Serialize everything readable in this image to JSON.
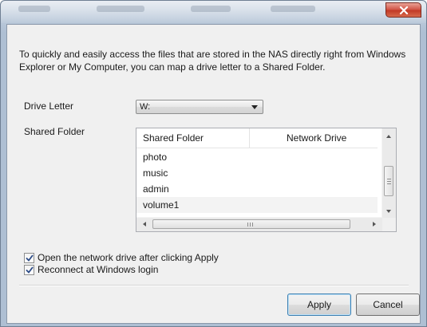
{
  "window": {
    "close_icon": "close-x-icon"
  },
  "intro_text": "To quickly and easily access the files that are stored in the NAS directly right from Windows Explorer or My Computer, you can map a drive letter to a Shared Folder.",
  "drive_letter": {
    "label": "Drive Letter",
    "selected": "W:"
  },
  "shared_folder": {
    "label": "Shared Folder",
    "columns": [
      "Shared Folder",
      "Network Drive"
    ],
    "rows": [
      "photo",
      "music",
      "admin",
      "volume1"
    ]
  },
  "options": {
    "open_after_apply": {
      "label": "Open the network drive after clicking Apply",
      "checked": true
    },
    "reconnect_at_login": {
      "label": "Reconnect at Windows login",
      "checked": true
    }
  },
  "buttons": {
    "apply": "Apply",
    "cancel": "Cancel"
  },
  "colors": {
    "accent": "#3c7fb1",
    "close": "#c23a26"
  }
}
